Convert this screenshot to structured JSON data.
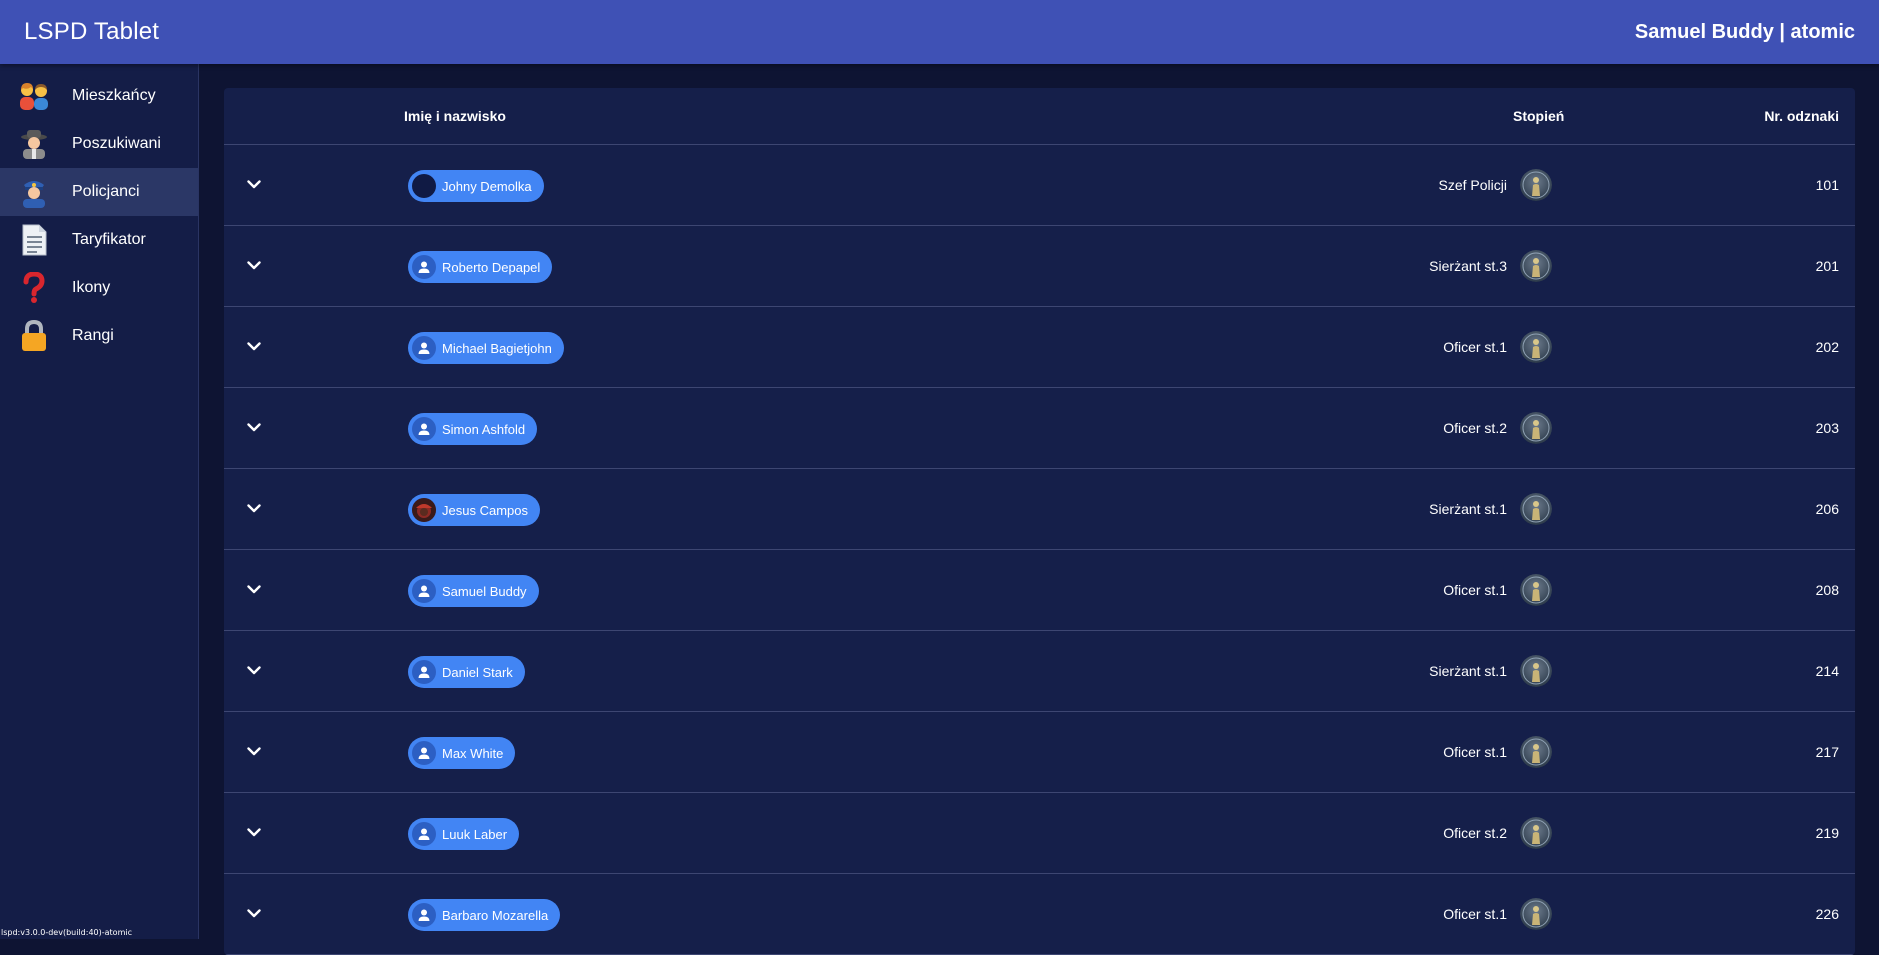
{
  "header": {
    "title": "LSPD Tablet",
    "user": "Samuel Buddy | atomic"
  },
  "sidebar": {
    "items": [
      {
        "label": "Mieszkańcy",
        "icon": "family-emoji-icon",
        "active": false
      },
      {
        "label": "Poszukiwani",
        "icon": "detective-emoji-icon",
        "active": false
      },
      {
        "label": "Policjanci",
        "icon": "police-officer-emoji-icon",
        "active": true
      },
      {
        "label": "Taryfikator",
        "icon": "document-page-icon",
        "active": false
      },
      {
        "label": "Ikony",
        "icon": "red-question-mark-icon",
        "active": false
      },
      {
        "label": "Rangi",
        "icon": "lock-icon",
        "active": false
      }
    ],
    "version": "lspd:v3.0.0-dev(build:40)-atomic"
  },
  "table": {
    "headers": {
      "name": "Imię i nazwisko",
      "rank": "Stopień",
      "badge": "Nr. odznaki"
    },
    "rows": [
      {
        "name": "Johny Demolka",
        "rank": "Szef Policji",
        "badge": "101",
        "avatar": "dark-photo"
      },
      {
        "name": "Roberto Depapel",
        "rank": "Sierżant st.3",
        "badge": "201",
        "avatar": "person-icon"
      },
      {
        "name": "Michael Bagietjohn",
        "rank": "Oficer st.1",
        "badge": "202",
        "avatar": "person-icon"
      },
      {
        "name": "Simon Ashfold",
        "rank": "Oficer st.2",
        "badge": "203",
        "avatar": "person-icon"
      },
      {
        "name": "Jesus Campos",
        "rank": "Sierżant st.1",
        "badge": "206",
        "avatar": "red-photo"
      },
      {
        "name": "Samuel Buddy",
        "rank": "Oficer st.1",
        "badge": "208",
        "avatar": "person-icon"
      },
      {
        "name": "Daniel Stark",
        "rank": "Sierżant st.1",
        "badge": "214",
        "avatar": "person-icon"
      },
      {
        "name": "Max White",
        "rank": "Oficer st.1",
        "badge": "217",
        "avatar": "person-icon"
      },
      {
        "name": "Luuk Laber",
        "rank": "Oficer st.2",
        "badge": "219",
        "avatar": "person-icon"
      },
      {
        "name": "Barbaro Mozarella",
        "rank": "Oficer st.1",
        "badge": "226",
        "avatar": "person-icon"
      }
    ]
  },
  "colors": {
    "header": "#3f51b5",
    "sidebar": "#141d47",
    "panel": "#151f4a",
    "chip": "#4285f4"
  }
}
